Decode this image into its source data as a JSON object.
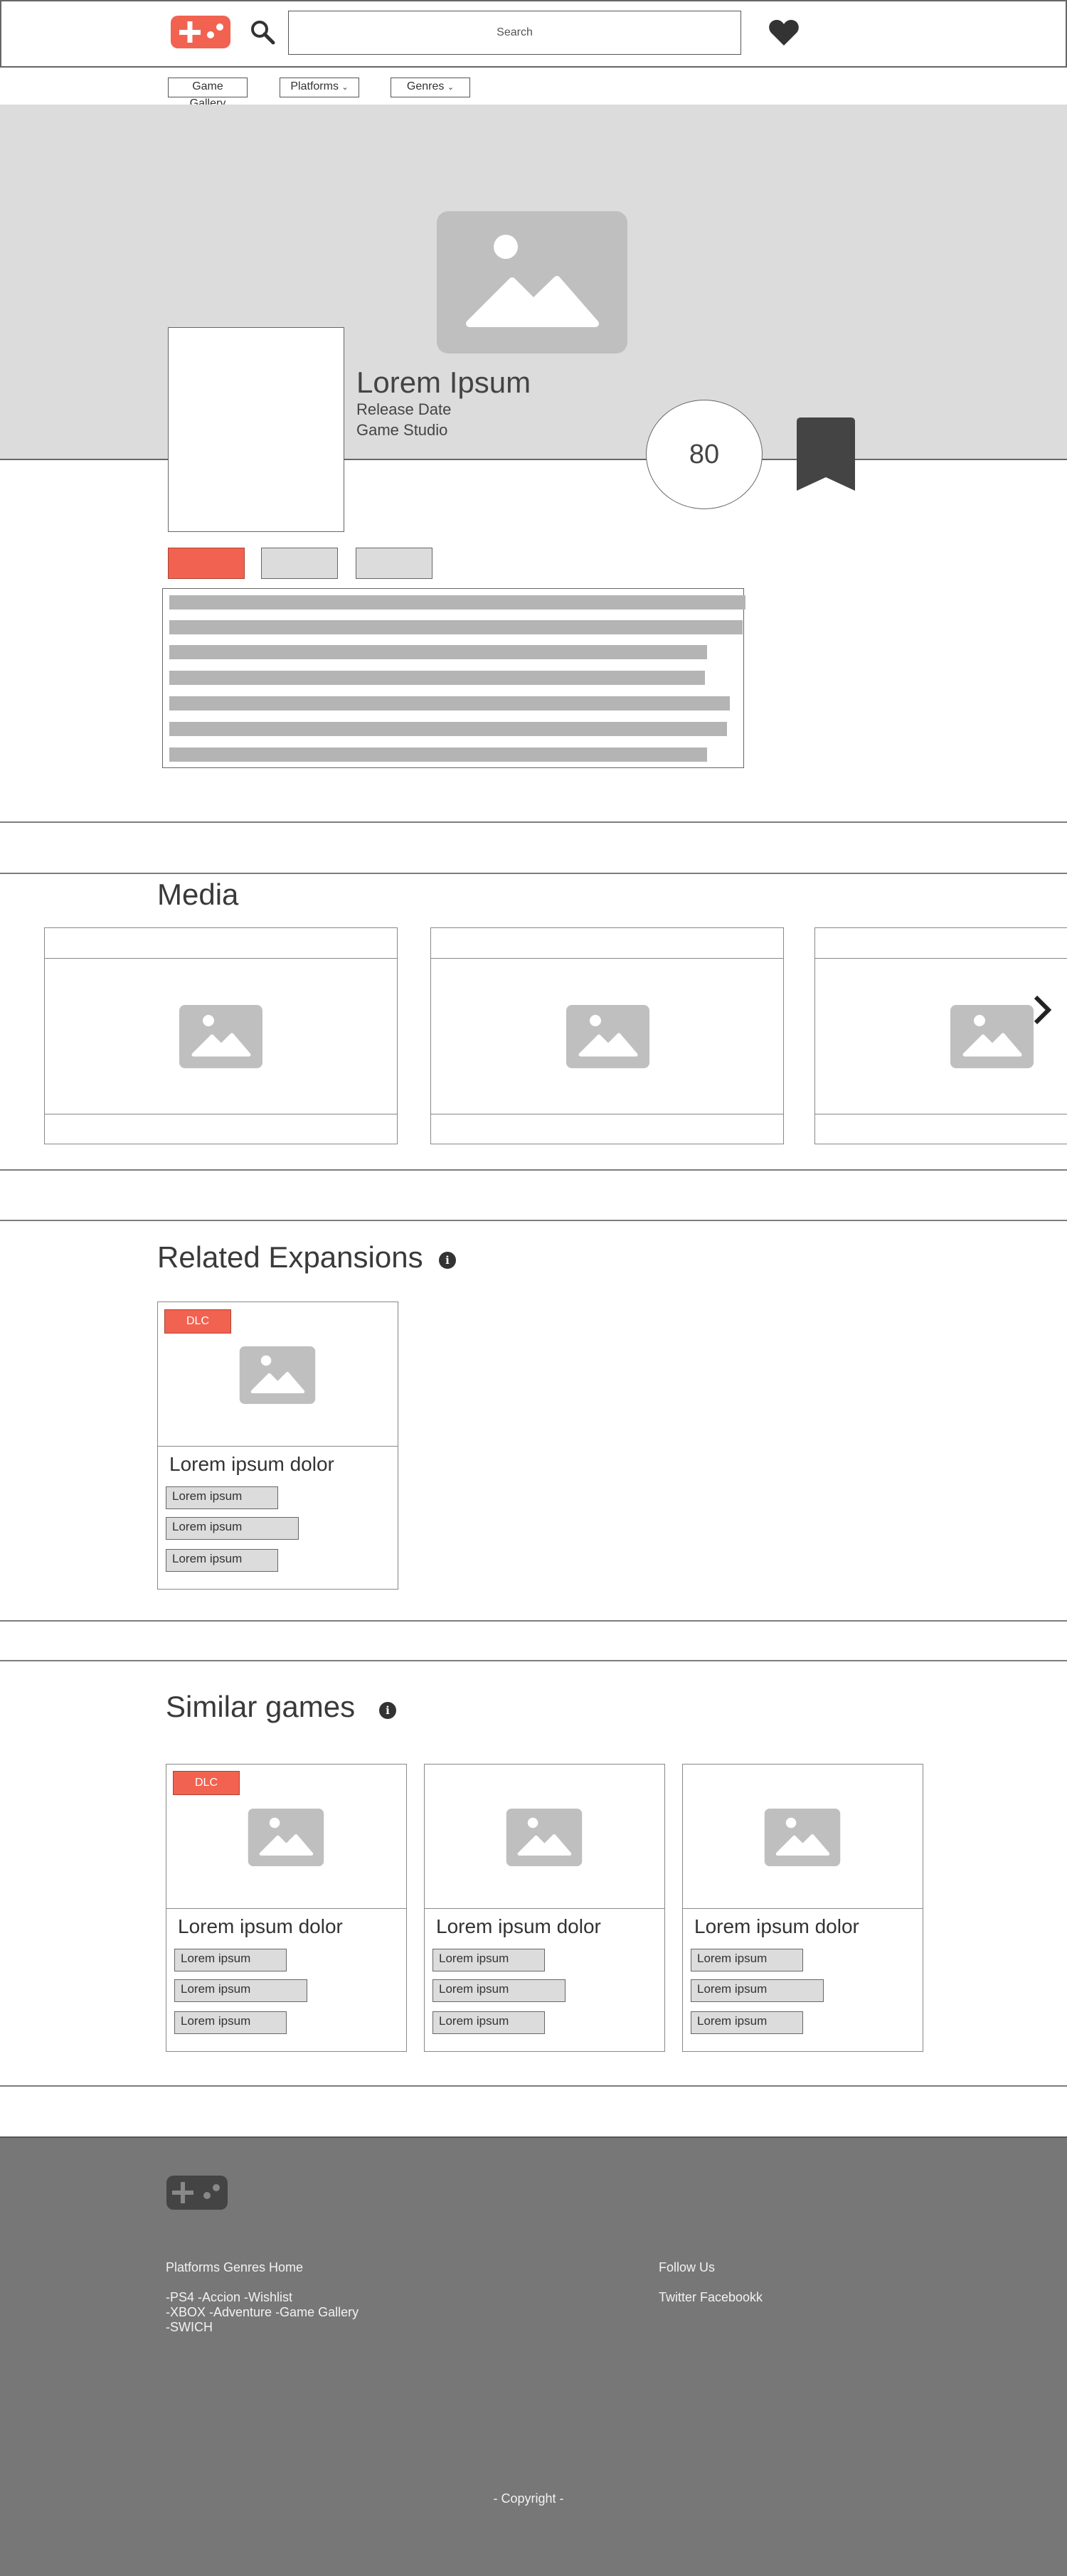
{
  "header": {
    "search_placeholder": "Search",
    "logo_icon": "gamepad-icon",
    "search_icon": "magnifier-icon",
    "favorites_icon": "heart-icon",
    "accent_color": "#f26250"
  },
  "nav": {
    "gallery_label": "Game Gallery",
    "platforms_label": "Platforms",
    "genres_label": "Genres"
  },
  "hero": {
    "title": "Lorem Ipsum",
    "release_date": "Release Date",
    "studio": "Game Studio",
    "score": "80",
    "bookmark_icon": "bookmark-icon"
  },
  "media": {
    "title": "Media",
    "next_icon": "chevron-right-icon"
  },
  "expansions": {
    "title": "Related Expansions",
    "info_icon": "i",
    "cards": [
      {
        "badge": "DLC",
        "title": "Lorem ipsum dolor",
        "tags": [
          "Lorem ipsum",
          "Lorem ipsum",
          "Lorem ipsum"
        ]
      }
    ]
  },
  "similar": {
    "title": "Similar games",
    "info_icon": "i",
    "cards": [
      {
        "badge": "DLC",
        "title": "Lorem ipsum dolor",
        "tags": [
          "Lorem ipsum",
          "Lorem ipsum",
          "Lorem ipsum"
        ]
      },
      {
        "title": "Lorem ipsum dolor",
        "tags": [
          "Lorem ipsum",
          "Lorem ipsum",
          "Lorem ipsum"
        ]
      },
      {
        "title": "Lorem ipsum dolor",
        "tags": [
          "Lorem ipsum",
          "Lorem ipsum",
          "Lorem ipsum"
        ]
      }
    ]
  },
  "footer": {
    "nav_heading": "Platforms Genres Home",
    "nav_lines": [
      "-PS4 -Accion -Wishlist",
      "-XBOX -Adventure -Game Gallery",
      "-SWICH"
    ],
    "follow_heading": "Follow Us",
    "social_links": "Twitter Facebookk",
    "copyright": "- Copyright -",
    "background": "#777777"
  }
}
